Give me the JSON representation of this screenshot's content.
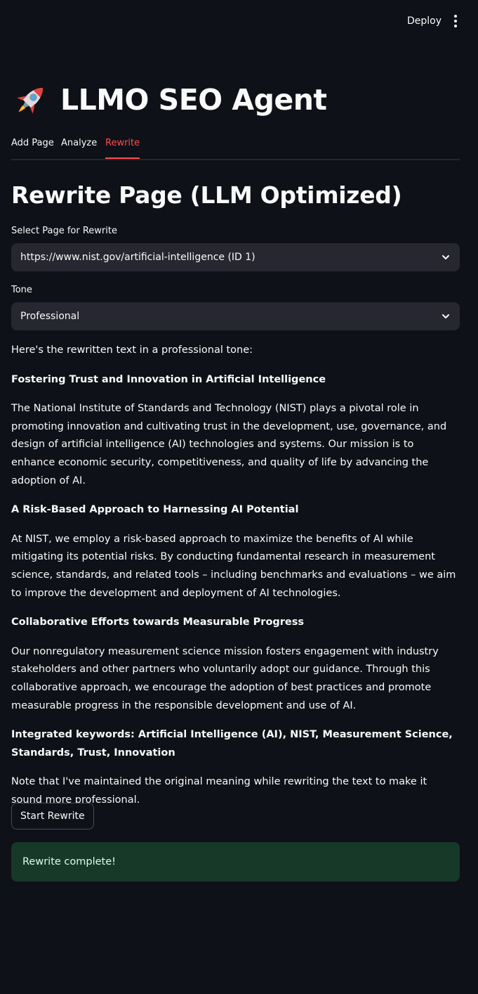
{
  "header": {
    "deploy_label": "Deploy",
    "menu_icon": "kebab-menu-icon"
  },
  "app": {
    "title": "LLMO SEO Agent",
    "title_icon": "rocket-icon"
  },
  "tabs": [
    {
      "label": "Add Page",
      "active": false
    },
    {
      "label": "Analyze",
      "active": false
    },
    {
      "label": "Rewrite",
      "active": true
    }
  ],
  "section": {
    "heading": "Rewrite Page (LLM Optimized)"
  },
  "page_select": {
    "label": "Select Page for Rewrite",
    "value": "https://www.nist.gov/artificial-intelligence (ID 1)"
  },
  "tone_select": {
    "label": "Tone",
    "value": "Professional"
  },
  "output": {
    "intro": "Here's the rewritten text in a professional tone:",
    "heading1": "Fostering Trust and Innovation in Artificial Intelligence",
    "para1": "The National Institute of Standards and Technology (NIST) plays a pivotal role in promoting innovation and cultivating trust in the development, use, governance, and design of artificial intelligence (AI) technologies and systems. Our mission is to enhance economic security, competitiveness, and quality of life by advancing the adoption of AI.",
    "heading2": "A Risk-Based Approach to Harnessing AI Potential",
    "para2": "At NIST, we employ a risk-based approach to maximize the benefits of AI while mitigating its potential risks. By conducting fundamental research in measurement science, standards, and related tools – including benchmarks and evaluations – we aim to improve the development and deployment of AI technologies.",
    "heading3": "Collaborative Efforts towards Measurable Progress",
    "para3": "Our nonregulatory measurement science mission fosters engagement with industry stakeholders and other partners who voluntarily adopt our guidance. Through this collaborative approach, we encourage the adoption of best practices and promote measurable progress in the responsible development and use of AI.",
    "keywords": "Integrated keywords: Artificial Intelligence (AI), NIST, Measurement Science, Standards, Trust, Innovation",
    "note": "Note that I've maintained the original meaning while rewriting the text to make it sound more professional."
  },
  "actions": {
    "start_rewrite_label": "Start Rewrite"
  },
  "status": {
    "message": "Rewrite complete!"
  },
  "colors": {
    "background": "#0e1117",
    "accent": "#ff4b4b",
    "input_bg": "#262730",
    "success_bg": "#173928"
  }
}
